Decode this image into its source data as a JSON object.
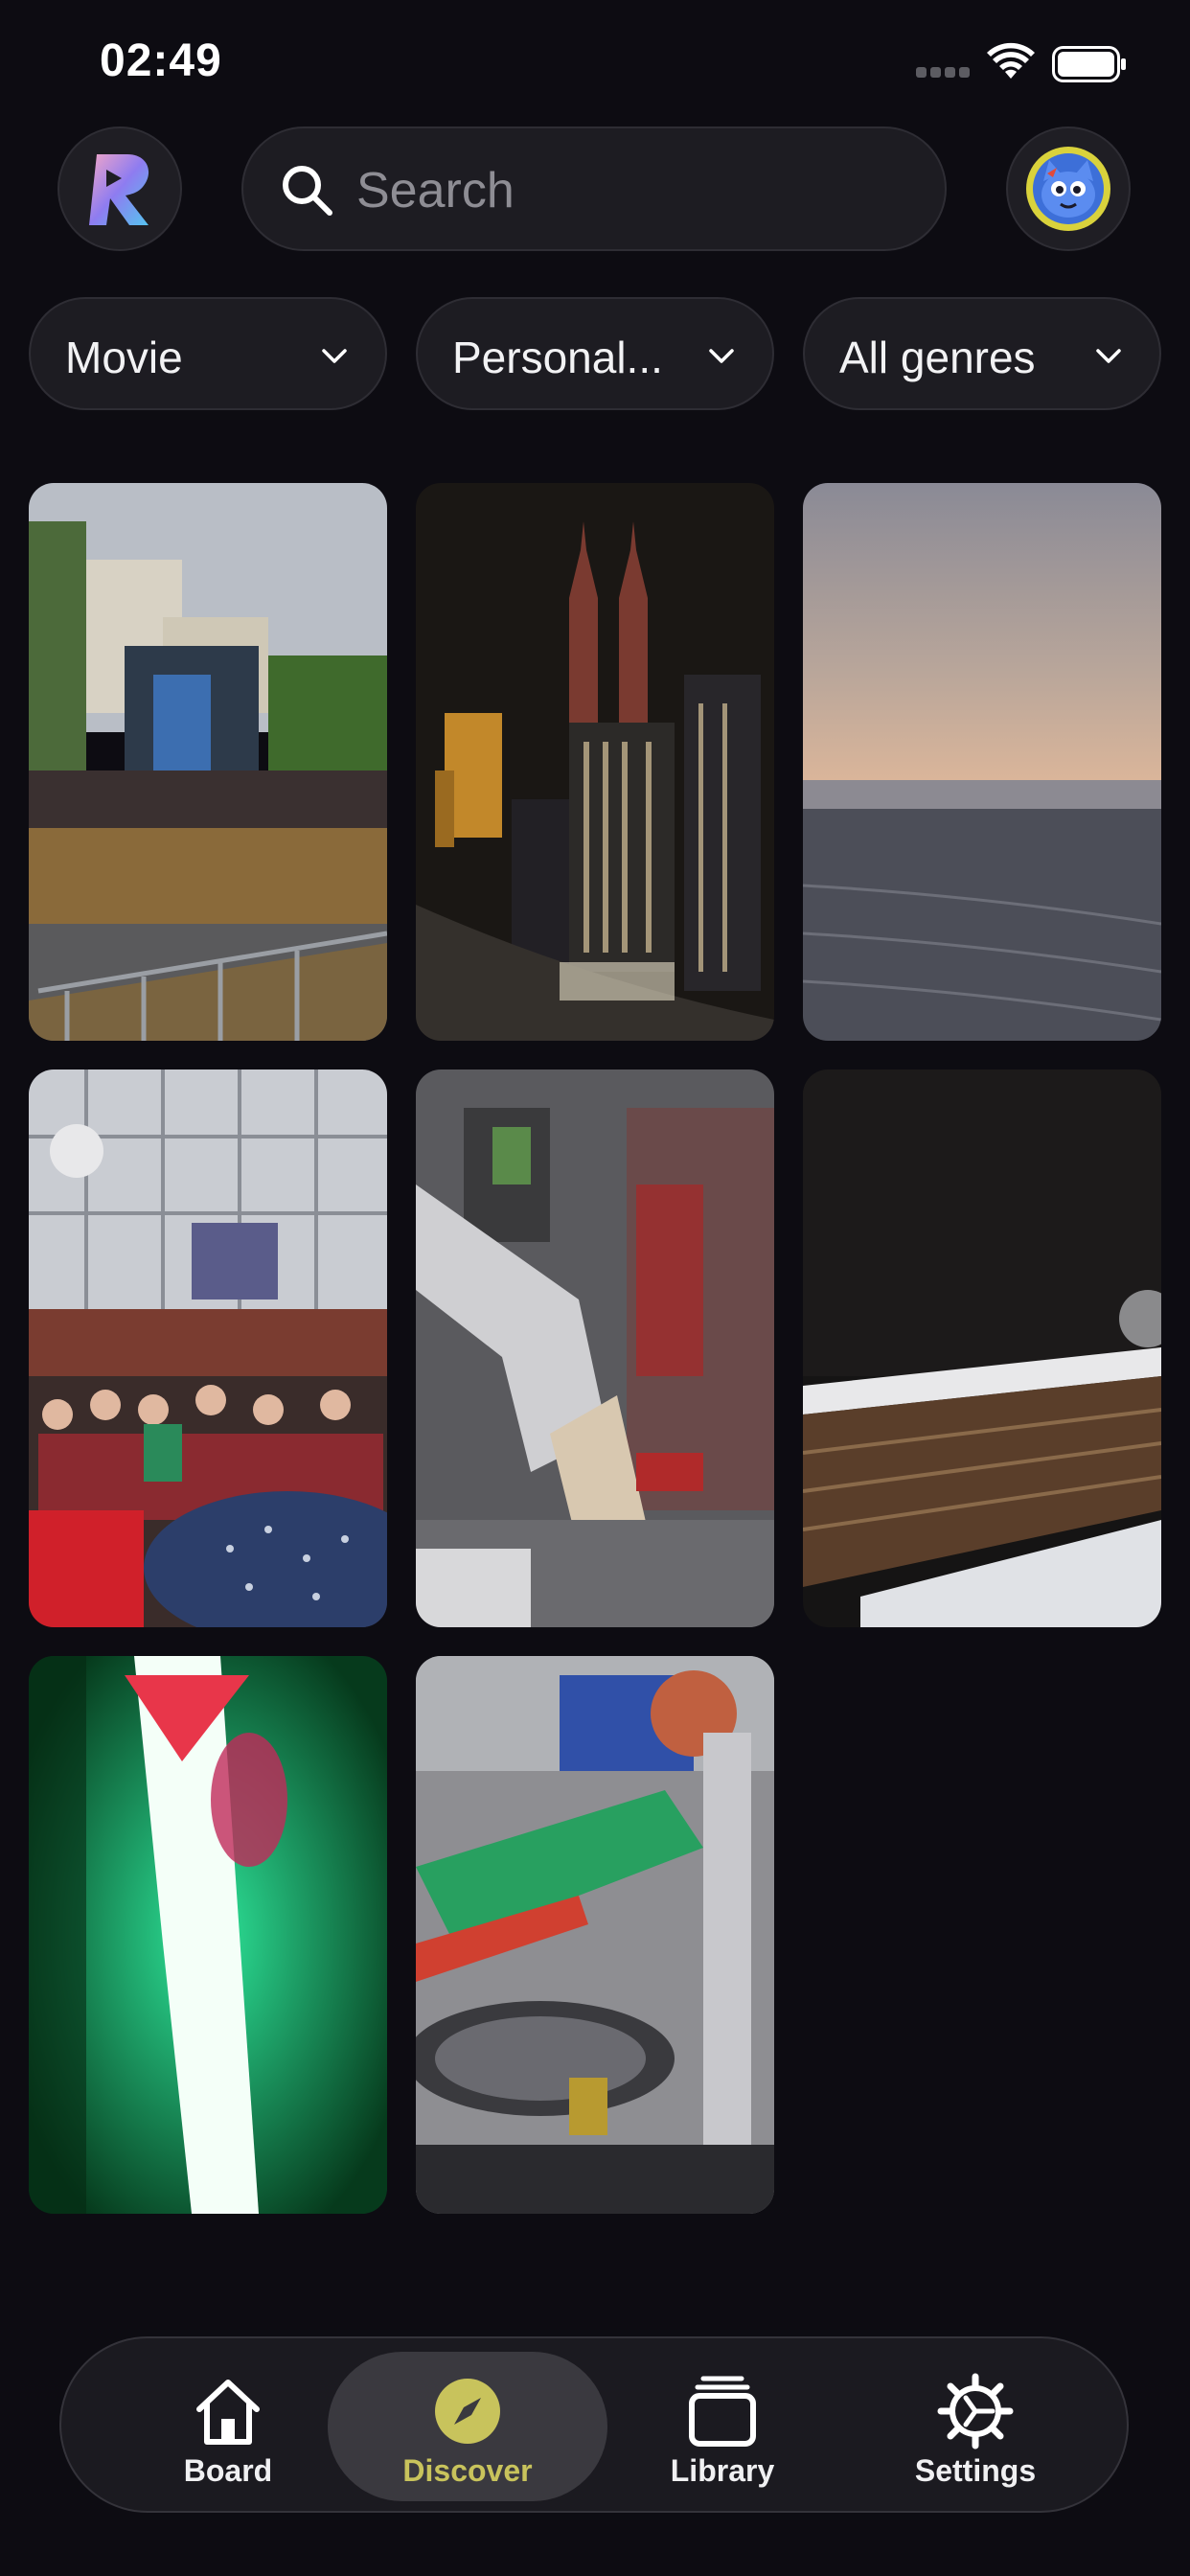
{
  "status_bar": {
    "time": "02:49"
  },
  "header": {
    "logo_icon": "app-logo-icon",
    "search": {
      "placeholder": "Search",
      "value": ""
    },
    "avatar_icon": "cat-avatar-icon"
  },
  "filters": [
    {
      "label": "Movie"
    },
    {
      "label": "Personal..."
    },
    {
      "label": "All genres"
    }
  ],
  "grid": {
    "tiles": [
      {
        "scene": "outdoor-festival-stage"
      },
      {
        "scene": "night-city-skyline-towers"
      },
      {
        "scene": "sea-at-sunset"
      },
      {
        "scene": "crowd-in-front-of-building"
      },
      {
        "scene": "blurred-robotic-arm"
      },
      {
        "scene": "factory-conveyor"
      },
      {
        "scene": "green-light-glare"
      },
      {
        "scene": "industrial-machine"
      }
    ]
  },
  "tabbar": {
    "tabs": [
      {
        "label": "Board",
        "icon": "house-icon",
        "active": false
      },
      {
        "label": "Discover",
        "icon": "compass-icon",
        "active": true
      },
      {
        "label": "Library",
        "icon": "stacked-cards-icon",
        "active": false
      },
      {
        "label": "Settings",
        "icon": "gear-icon",
        "active": false
      }
    ]
  },
  "colors": {
    "background": "#0d0c12",
    "surface": "#1d1c22",
    "active_tab_bg": "#3a393f",
    "accent": "#c8c35c"
  }
}
